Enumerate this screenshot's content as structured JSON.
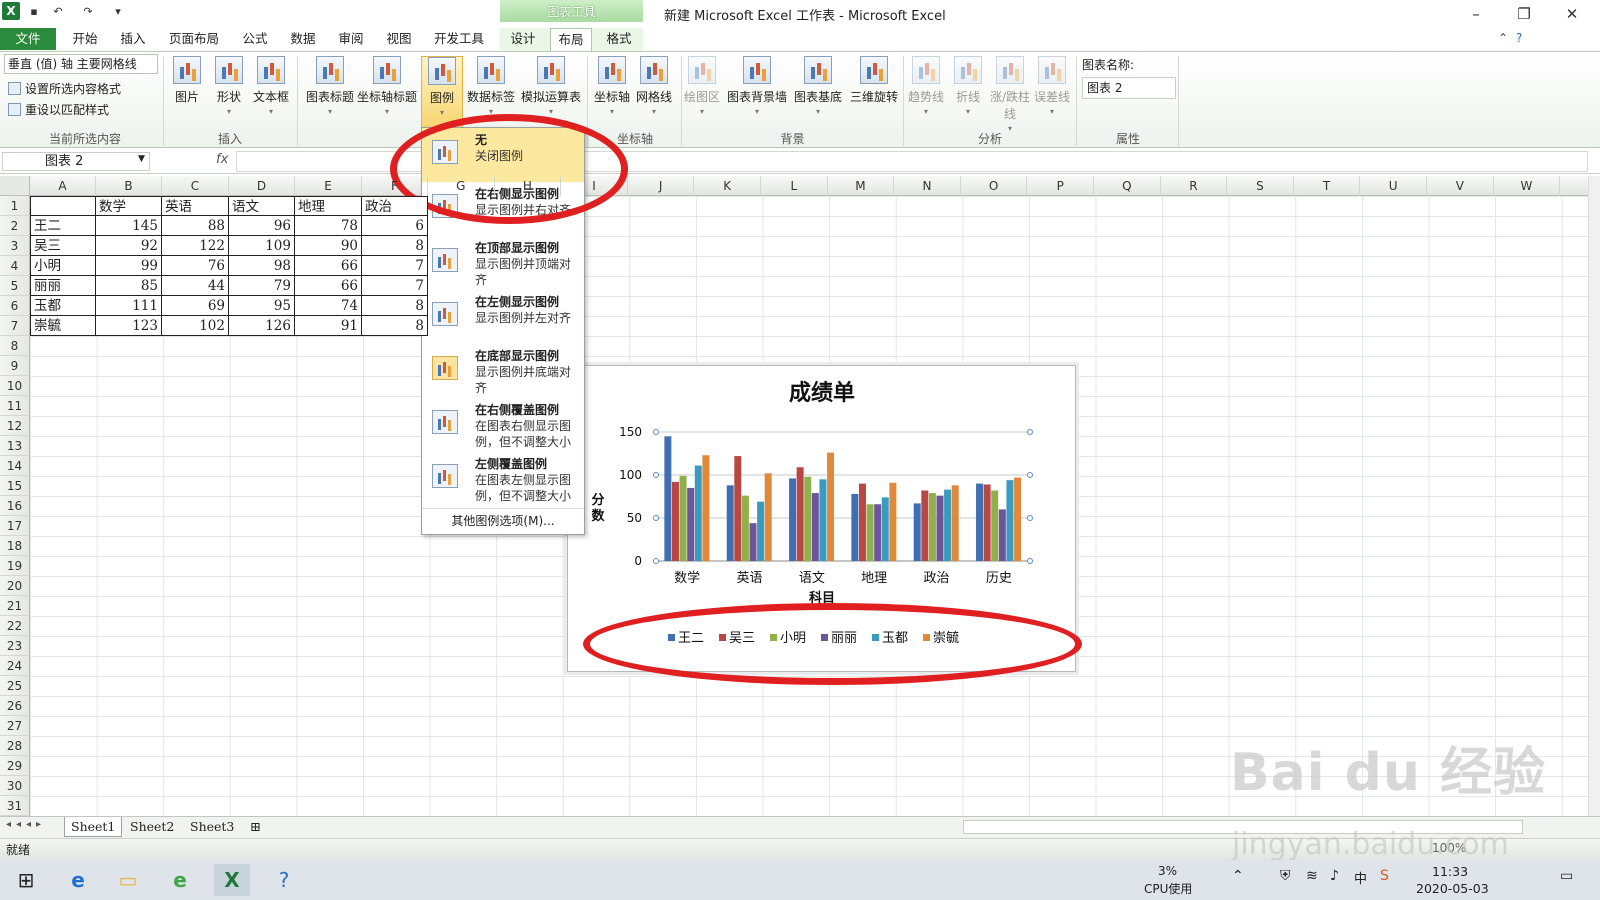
{
  "window": {
    "title": "新建 Microsoft Excel 工作表 - Microsoft Excel",
    "context_tab": "图表工具"
  },
  "tabs": [
    "文件",
    "开始",
    "插入",
    "页面布局",
    "公式",
    "数据",
    "审阅",
    "视图",
    "开发工具",
    "设计",
    "布局",
    "格式"
  ],
  "ribbon": {
    "selection_dropdown": "垂直 (值) 轴 主要网格线",
    "format_selection": "设置所选内容格式",
    "reset_style": "重设以匹配样式",
    "groups": [
      "当前所选内容",
      "插入",
      "坐标轴",
      "背景",
      "分析",
      "属性"
    ],
    "insert_buttons": [
      "图片",
      "形状",
      "文本框"
    ],
    "label_buttons": [
      "图表标题",
      "坐标轴标题",
      "图例",
      "数据标签",
      "模拟运算表"
    ],
    "axis_buttons": [
      "坐标轴",
      "网格线"
    ],
    "background_buttons": [
      "绘图区",
      "图表背景墙",
      "图表基底",
      "三维旋转"
    ],
    "analysis_buttons": [
      "趋势线",
      "折线",
      "涨/跌柱线",
      "误差线"
    ],
    "chart_name_label": "图表名称:",
    "chart_name_value": "图表 2"
  },
  "formula_bar": {
    "name_box": "图表 2",
    "fx": "fx"
  },
  "columns": [
    "A",
    "B",
    "C",
    "D",
    "E",
    "F",
    "G",
    "H",
    "I",
    "J",
    "K",
    "L",
    "M",
    "N",
    "O",
    "P",
    "Q",
    "R",
    "S",
    "T",
    "U",
    "V",
    "W"
  ],
  "rows": [
    "1",
    "2",
    "3",
    "4",
    "5",
    "6",
    "7",
    "8",
    "9",
    "10",
    "11",
    "12",
    "13",
    "14",
    "15",
    "16",
    "17",
    "18",
    "19",
    "20",
    "21",
    "22",
    "23",
    "24",
    "25",
    "26",
    "27",
    "28",
    "29",
    "30",
    "31"
  ],
  "table": {
    "headers": [
      "",
      "数学",
      "英语",
      "语文",
      "地理",
      "政治"
    ],
    "data": [
      [
        "王二",
        "145",
        "88",
        "96",
        "78",
        "6"
      ],
      [
        "吴三",
        "92",
        "122",
        "109",
        "90",
        "8"
      ],
      [
        "小明",
        "99",
        "76",
        "98",
        "66",
        "7"
      ],
      [
        "丽丽",
        "85",
        "44",
        "79",
        "66",
        "7"
      ],
      [
        "玉都",
        "111",
        "69",
        "95",
        "74",
        "8"
      ],
      [
        "崇毓",
        "123",
        "102",
        "126",
        "91",
        "8"
      ]
    ]
  },
  "legend_menu": {
    "items": [
      {
        "title": "无",
        "desc": "关闭图例"
      },
      {
        "title": "在右侧显示图例",
        "desc": "显示图例并右对齐"
      },
      {
        "title": "在顶部显示图例",
        "desc": "显示图例并顶端对齐"
      },
      {
        "title": "在左侧显示图例",
        "desc": "显示图例并左对齐"
      },
      {
        "title": "在底部显示图例",
        "desc": "显示图例并底端对齐"
      },
      {
        "title": "在右侧覆盖图例",
        "desc": "在图表右侧显示图例，但不调整大小"
      },
      {
        "title": "左侧覆盖图例",
        "desc": "在图表左侧显示图例，但不调整大小"
      }
    ],
    "more": "其他图例选项(M)..."
  },
  "colors": {
    "series": [
      "#3f6fb0",
      "#b94744",
      "#8fb04a",
      "#6e559a",
      "#3a9bbf",
      "#e0893a"
    ],
    "annotation": "#e02020",
    "file_tab": "#2a8b3c"
  },
  "chart_data": {
    "type": "bar",
    "title": "成绩单",
    "ylabel": "分数",
    "xlabel": "科目",
    "categories": [
      "数学",
      "英语",
      "语文",
      "地理",
      "政治",
      "历史"
    ],
    "ylim": [
      0,
      150
    ],
    "yticks": [
      0,
      50,
      100,
      150
    ],
    "legend_position": "bottom",
    "series": [
      {
        "name": "王二",
        "values": [
          145,
          88,
          96,
          78,
          67,
          90
        ]
      },
      {
        "name": "吴三",
        "values": [
          92,
          122,
          109,
          90,
          82,
          89
        ]
      },
      {
        "name": "小明",
        "values": [
          99,
          76,
          98,
          66,
          79,
          82
        ]
      },
      {
        "name": "丽丽",
        "values": [
          85,
          44,
          79,
          66,
          76,
          60
        ]
      },
      {
        "name": "玉都",
        "values": [
          111,
          69,
          95,
          74,
          83,
          94
        ]
      },
      {
        "name": "崇毓",
        "values": [
          123,
          102,
          126,
          91,
          88,
          97
        ]
      }
    ]
  },
  "sheets": [
    "Sheet1",
    "Sheet2",
    "Sheet3"
  ],
  "status": {
    "ready": "就绪",
    "zoom": "100%"
  },
  "taskbar": {
    "cpu_percent": "3%",
    "cpu_label": "CPU使用",
    "time": "11:33",
    "date": "2020-05-03",
    "ime": "中"
  },
  "watermark": {
    "brand": "Bai du 经验",
    "site": "jingyan.baidu.com"
  }
}
